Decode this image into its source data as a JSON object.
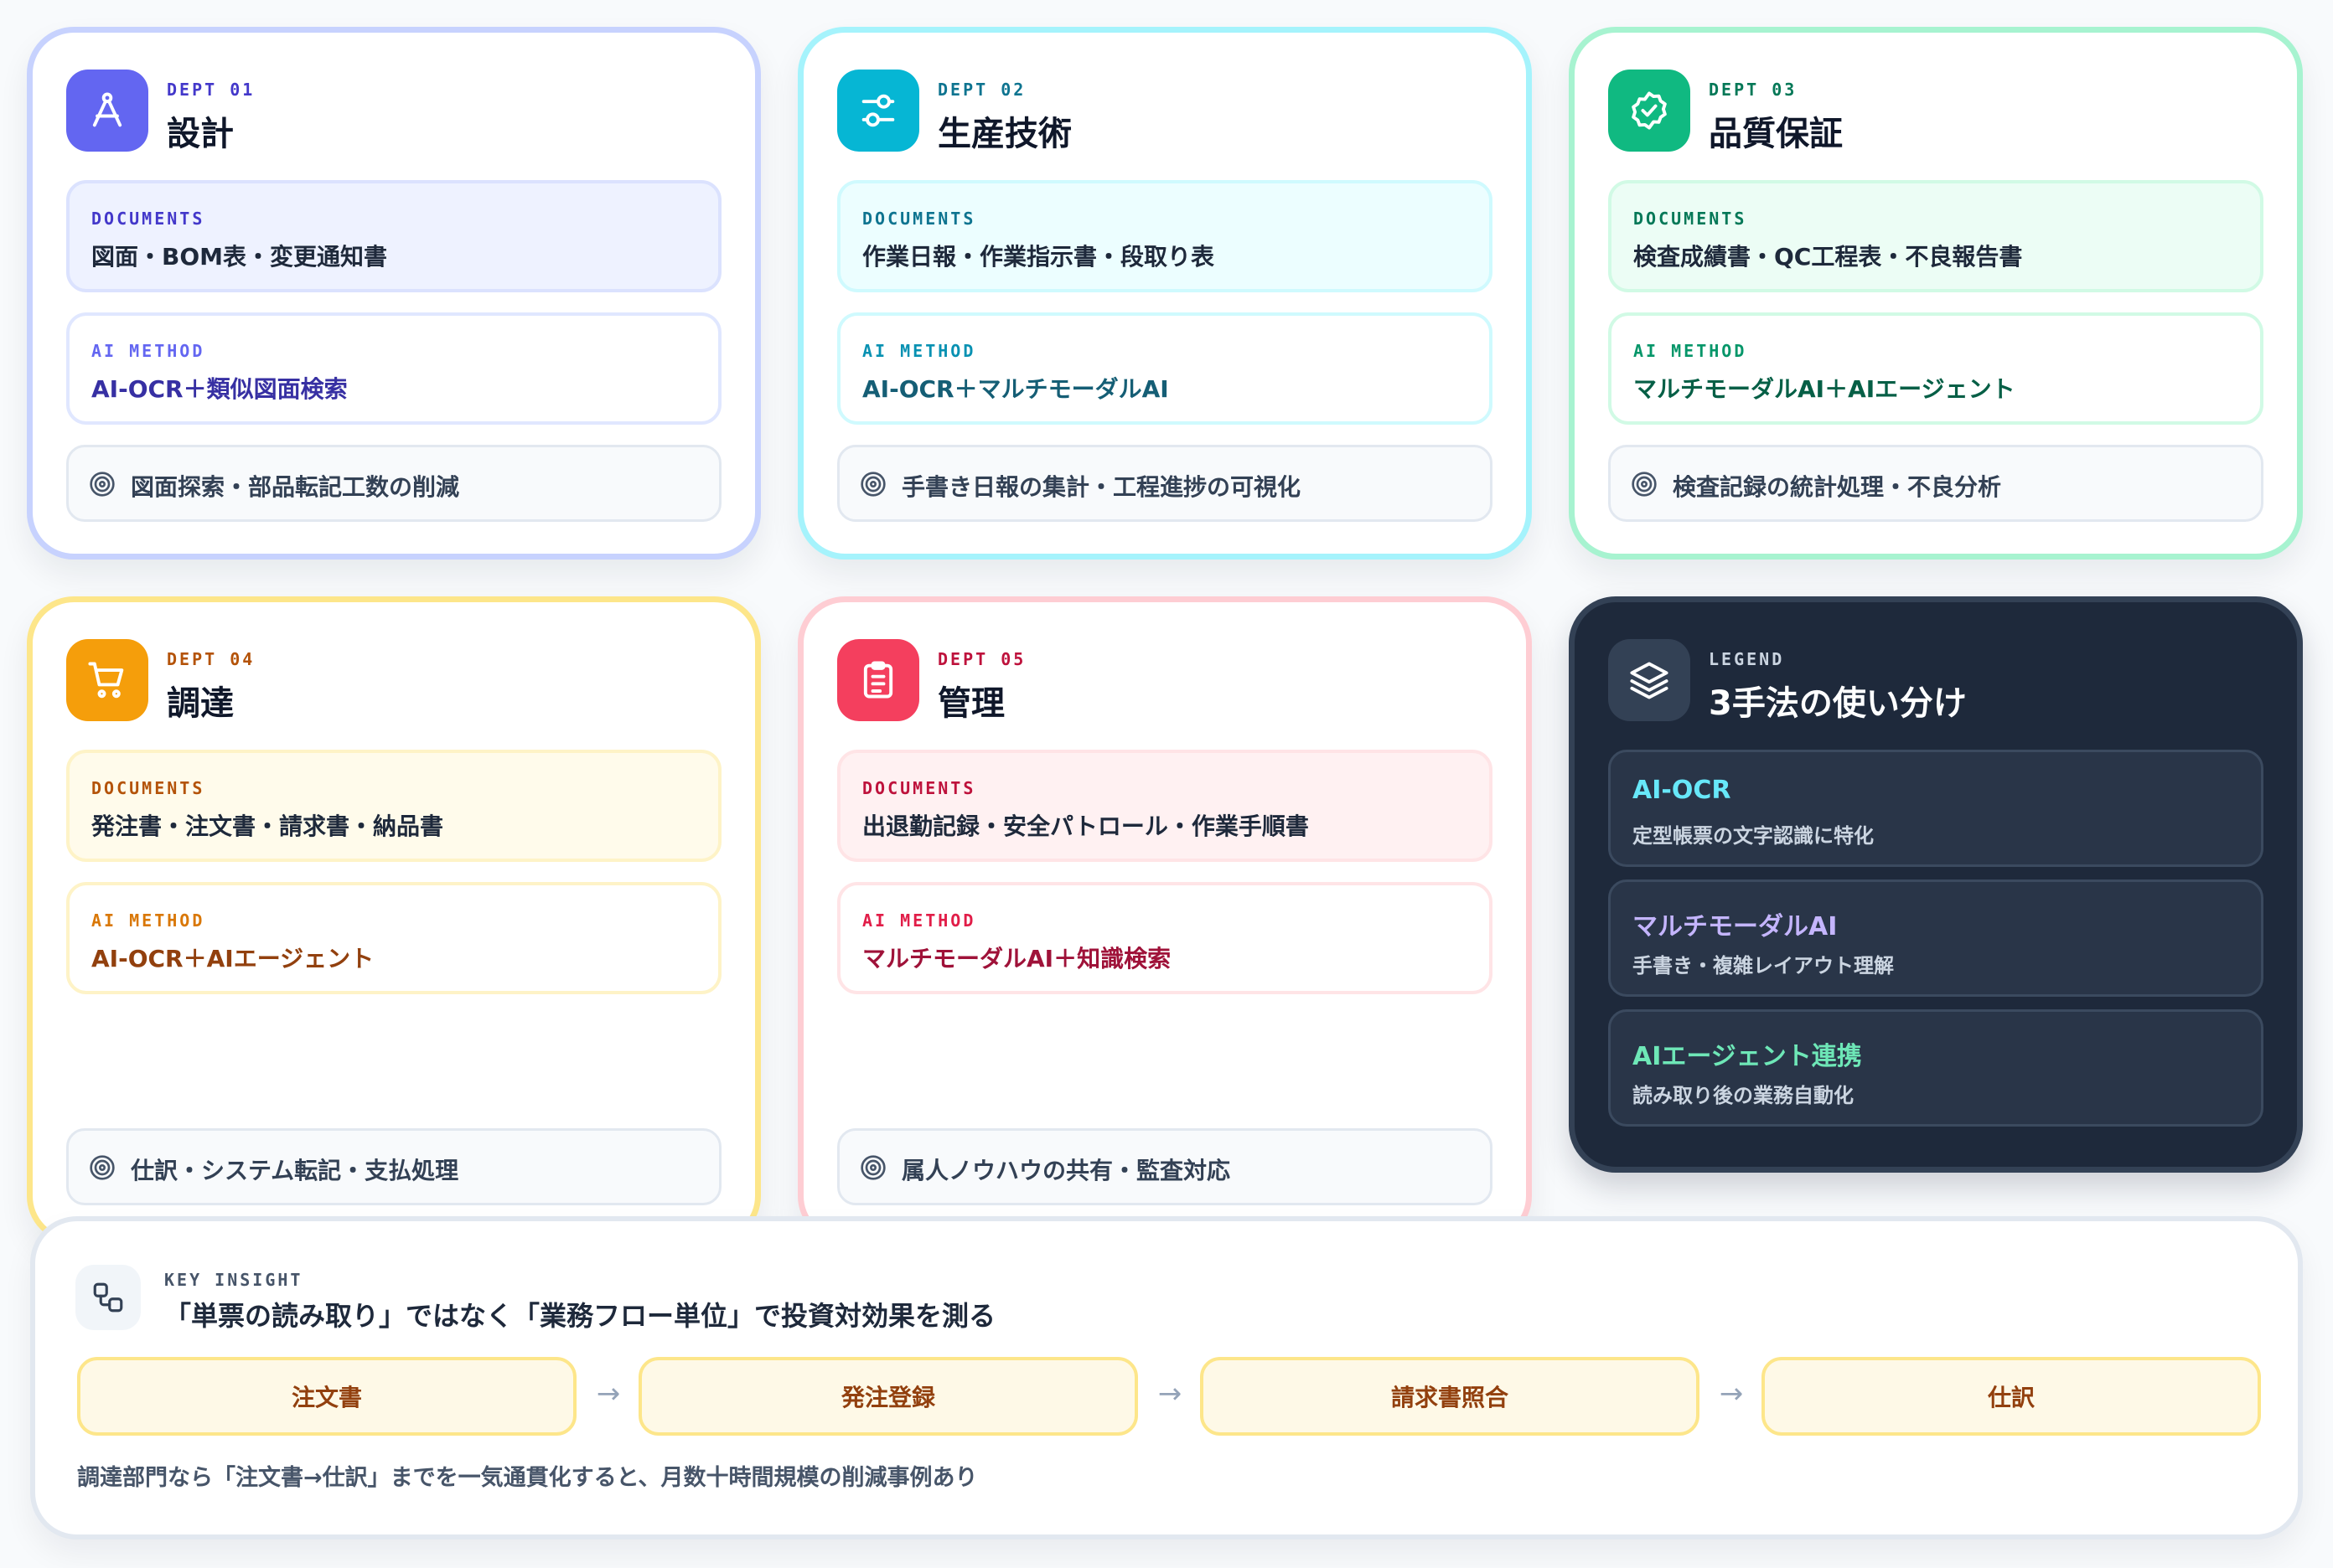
{
  "departments": [
    {
      "label": "DEPT 01",
      "title": "設計",
      "icon": "compass-icon",
      "accent": "#6366f1",
      "documents_label": "DOCUMENTS",
      "documents": "図面・BOM表・変更通知書",
      "ai_method_label": "AI METHOD",
      "ai_method": "AI-OCR＋類似図面検索",
      "goal": "図面探索・部品転記工数の削減"
    },
    {
      "label": "DEPT 02",
      "title": "生産技術",
      "icon": "sliders-icon",
      "accent": "#06b6d4",
      "documents_label": "DOCUMENTS",
      "documents": "作業日報・作業指示書・段取り表",
      "ai_method_label": "AI METHOD",
      "ai_method": "AI-OCR＋マルチモーダルAI",
      "goal": "手書き日報の集計・工程進捗の可視化"
    },
    {
      "label": "DEPT 03",
      "title": "品質保証",
      "icon": "badge-check-icon",
      "accent": "#10b981",
      "documents_label": "DOCUMENTS",
      "documents": "検査成績書・QC工程表・不良報告書",
      "ai_method_label": "AI METHOD",
      "ai_method": "マルチモーダルAI＋AIエージェント",
      "goal": "検査記録の統計処理・不良分析"
    },
    {
      "label": "DEPT 04",
      "title": "調達",
      "icon": "shopping-cart-icon",
      "accent": "#f59e0b",
      "documents_label": "DOCUMENTS",
      "documents": "発注書・注文書・請求書・納品書",
      "ai_method_label": "AI METHOD",
      "ai_method": "AI-OCR＋AIエージェント",
      "goal": "仕訳・システム転記・支払処理"
    },
    {
      "label": "DEPT 05",
      "title": "管理",
      "icon": "clipboard-list-icon",
      "accent": "#f43f5e",
      "documents_label": "DOCUMENTS",
      "documents": "出退勤記録・安全パトロール・作業手順書",
      "ai_method_label": "AI METHOD",
      "ai_method": "マルチモーダルAI＋知識検索",
      "goal": "属人ノウハウの共有・監査対応"
    }
  ],
  "legend": {
    "label": "LEGEND",
    "title": "3手法の使い分け",
    "icon": "layers-icon",
    "items": [
      {
        "name": "AI-OCR",
        "desc": "定型帳票の文字認識に特化",
        "color": "#67e8f9"
      },
      {
        "name": "マルチモーダルAI",
        "desc": "手書き・複雑レイアウト理解",
        "color": "#c4b5fd"
      },
      {
        "name": "AIエージェント連携",
        "desc": "読み取り後の業務自動化",
        "color": "#6ee7b7"
      }
    ]
  },
  "insight": {
    "label": "KEY INSIGHT",
    "icon": "workflow-icon",
    "title": "「単票の読み取り」ではなく「業務フロー単位」で投資対効果を測る",
    "flow": [
      "注文書",
      "発注登録",
      "請求書照合",
      "仕訳"
    ],
    "arrow": "→",
    "note": "調達部門なら「注文書→仕訳」までを一気通貫化すると、月数十時間規模の削減事例あり"
  }
}
